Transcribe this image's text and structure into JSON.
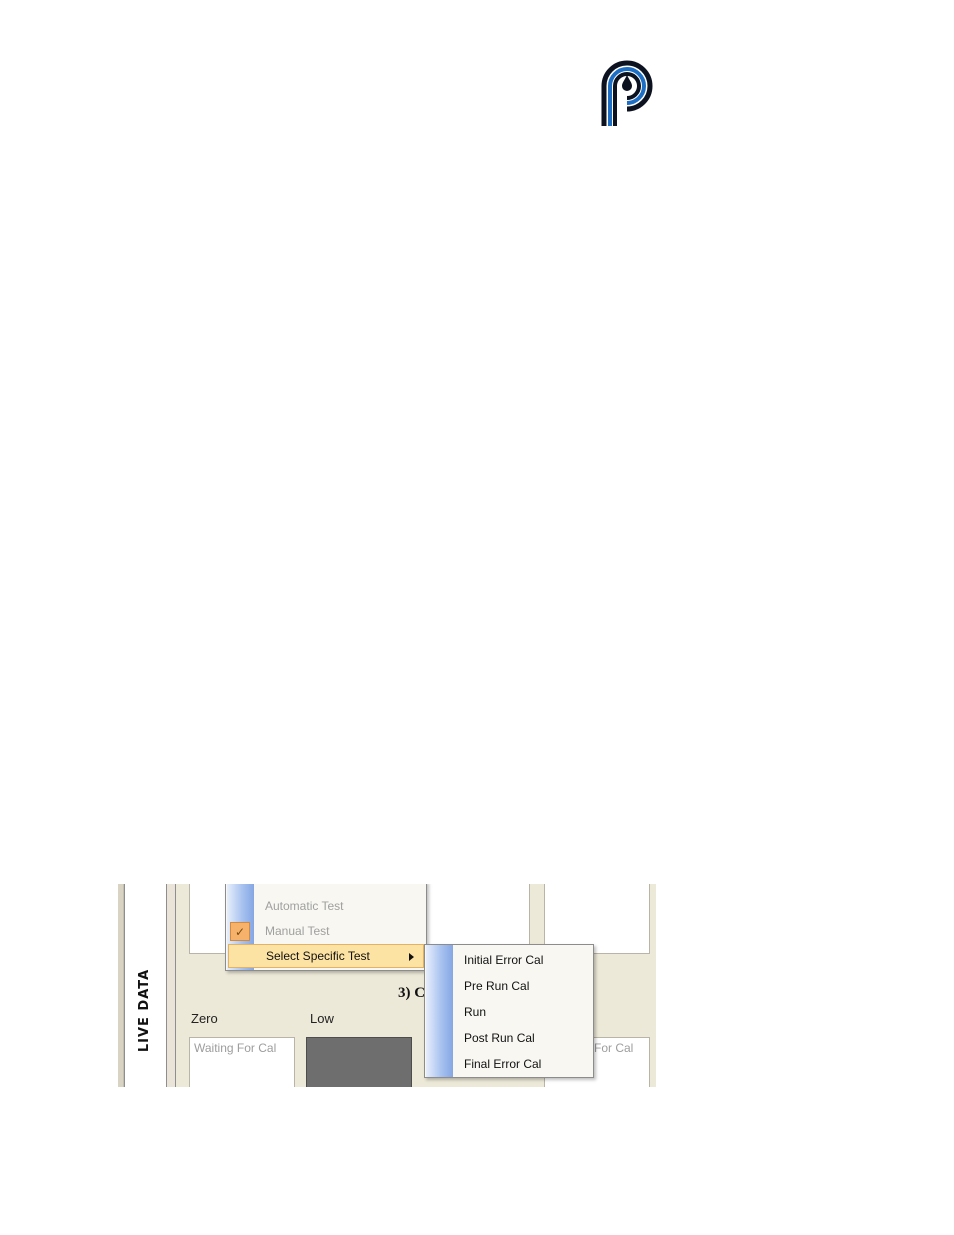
{
  "logo": {
    "name": "p-droplet-logo",
    "colors": {
      "dark": "#0d1220",
      "blue": "#1e6fc4"
    }
  },
  "panel": {
    "side_label": "LIVE DATA",
    "section_heading": "3) C",
    "columns": [
      {
        "label": "Zero",
        "status": "Waiting For Cal"
      },
      {
        "label": "Low",
        "status": ""
      }
    ],
    "right_status_partial": "For Cal"
  },
  "context_menu": {
    "items": [
      {
        "label": "Automatic Test",
        "enabled": false,
        "checked": false
      },
      {
        "label": "Manual Test",
        "enabled": false,
        "checked": true
      },
      {
        "label": "Select Specific Test",
        "enabled": true,
        "highlighted": true,
        "has_submenu": true
      }
    ]
  },
  "submenu": {
    "items": [
      {
        "label": "Initial Error Cal"
      },
      {
        "label": "Pre Run Cal"
      },
      {
        "label": "Run"
      },
      {
        "label": "Post Run Cal"
      },
      {
        "label": "Final Error Cal"
      }
    ]
  },
  "colors": {
    "panel_bg": "#ece9d8",
    "menu_highlight": "#fde3a3",
    "menu_gutter_blue": "#85a6e4",
    "low_box_fill": "#6e6e6e"
  }
}
